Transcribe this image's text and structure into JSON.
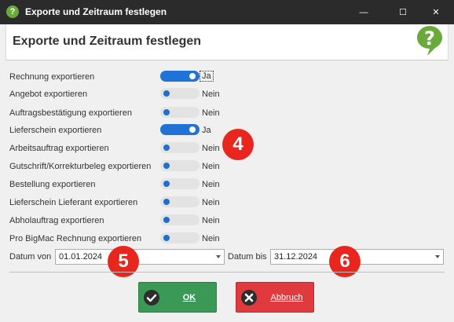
{
  "window": {
    "title": "Exporte und Zeitraum festlegen",
    "controls": {
      "minimize": "—",
      "maximize": "☐",
      "close": "✕"
    }
  },
  "header": {
    "title": "Exporte und Zeitraum festlegen",
    "icon": "help-icon"
  },
  "exports": [
    {
      "label": "Rechnung exportieren",
      "on": true,
      "state": "Ja"
    },
    {
      "label": "Angebot exportieren",
      "on": false,
      "state": "Nein"
    },
    {
      "label": "Auftragsbestätigung exportieren",
      "on": false,
      "state": "Nein"
    },
    {
      "label": "Lieferschein exportieren",
      "on": true,
      "state": "Ja"
    },
    {
      "label": "Arbeitsauftrag exportieren",
      "on": false,
      "state": "Nein"
    },
    {
      "label": "Gutschrift/Korrekturbeleg exportieren",
      "on": false,
      "state": "Nein"
    },
    {
      "label": "Bestellung exportieren",
      "on": false,
      "state": "Nein"
    },
    {
      "label": "Lieferschein Lieferant exportieren",
      "on": false,
      "state": "Nein"
    },
    {
      "label": "Abholauftrag exportieren",
      "on": false,
      "state": "Nein"
    },
    {
      "label": "Pro BigMac Rechnung exportieren",
      "on": false,
      "state": "Nein"
    }
  ],
  "date_from": {
    "label": "Datum von",
    "value": "01.01.2024"
  },
  "date_to": {
    "label": "Datum bis",
    "value": "31.12.2024"
  },
  "badges": [
    "4",
    "5",
    "6"
  ],
  "buttons": {
    "ok": "OK",
    "cancel": "Abbruch"
  },
  "colors": {
    "toggle_on": "#2172d6",
    "ok": "#3a9954",
    "cancel": "#e03a3e",
    "badge": "#e8261e"
  }
}
